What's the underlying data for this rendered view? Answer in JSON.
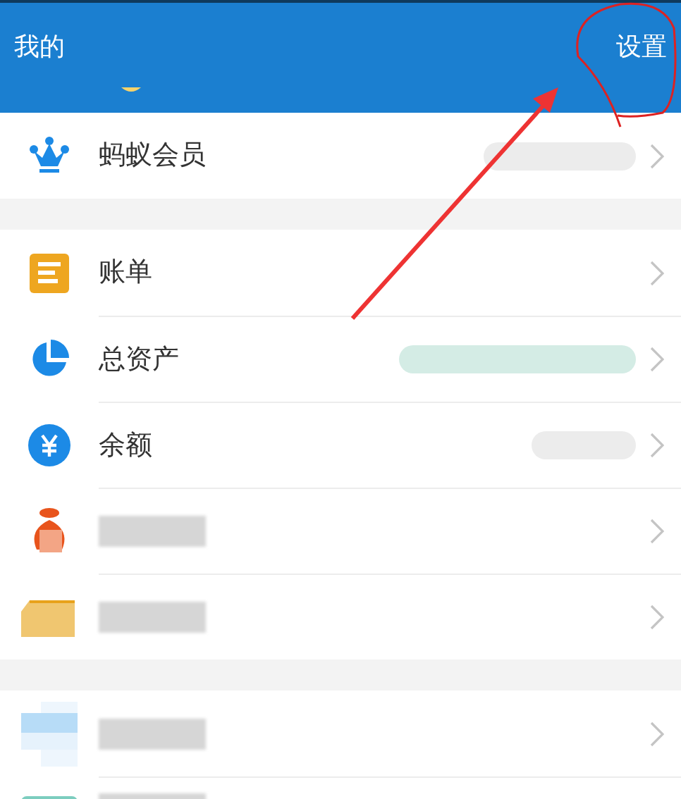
{
  "header": {
    "title": "我的",
    "action": "设置"
  },
  "sections": [
    {
      "rows": [
        {
          "kind": "text",
          "label": "蚂蚁会员",
          "masked_value": true
        }
      ]
    },
    {
      "rows": [
        {
          "kind": "text",
          "label": "账单",
          "masked_value": false
        },
        {
          "kind": "text",
          "label": "总资产",
          "masked_value": true
        },
        {
          "kind": "text",
          "label": "余额",
          "masked_value": true
        },
        {
          "kind": "masked",
          "masked_value": false
        },
        {
          "kind": "masked",
          "masked_value": false
        }
      ]
    },
    {
      "rows": [
        {
          "kind": "masked",
          "masked_value": false
        },
        {
          "kind": "masked",
          "masked_value": false
        }
      ]
    }
  ]
}
